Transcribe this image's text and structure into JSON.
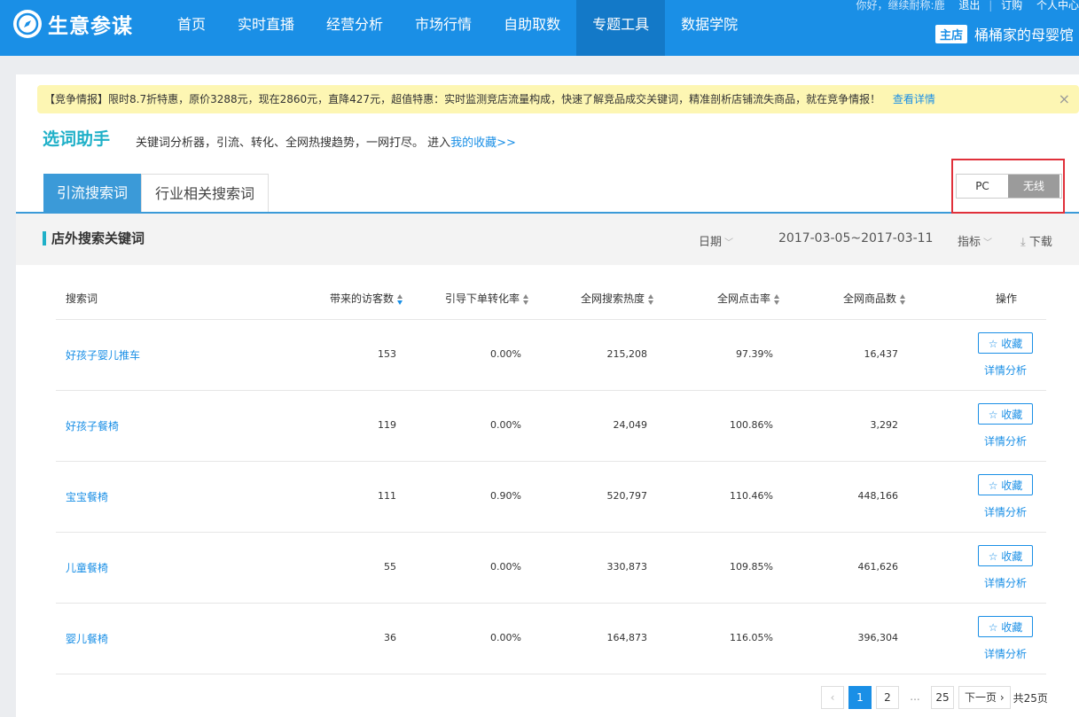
{
  "app": {
    "name": "生意参谋"
  },
  "nav": [
    {
      "label": "首页"
    },
    {
      "label": "实时直播"
    },
    {
      "label": "经营分析"
    },
    {
      "label": "市场行情"
    },
    {
      "label": "自助取数"
    },
    {
      "label": "专题工具",
      "active": true
    },
    {
      "label": "数据学院"
    }
  ],
  "user": {
    "greeting": "你好，继续耐称:鹿",
    "logout": "退出",
    "order": "订购",
    "personal": "个人中心",
    "shop_badge": "主店",
    "shop_name": "桶桶家的母婴馆"
  },
  "notice": {
    "text": "【竞争情报】限时8.7折特惠，原价3288元，现在2860元，直降427元，超值特惠：实时监测竞店流量构成，快速了解竞品成交关键词，精准剖析店铺流失商品，就在竞争情报！",
    "link": "查看详情",
    "close": "×"
  },
  "page": {
    "title": "选词助手",
    "subtitle": "关键词分析器，引流、转化、全网热搜趋势，一网打尽。 进入",
    "subtitle_link": "我的收藏>>"
  },
  "tabs": [
    {
      "label": "引流搜索词",
      "active": true
    },
    {
      "label": "行业相关搜索词",
      "active": false
    }
  ],
  "device": {
    "pc": "PC",
    "wireless": "无线",
    "selected": "无线"
  },
  "section": {
    "title": "店外搜索关键词",
    "date_label": "日期",
    "date_range": "2017-03-05~2017-03-11",
    "metric_label": "指标",
    "download": "下载"
  },
  "table": {
    "headers": {
      "keyword": "搜索词",
      "visitors": "带来的访客数",
      "conversion": "引导下单转化率",
      "search_heat": "全网搜索热度",
      "ctr": "全网点击率",
      "products": "全网商品数",
      "action": "操作"
    },
    "fav_label": "收藏",
    "detail_label": "详情分析",
    "rows": [
      {
        "keyword": "好孩子婴儿推车",
        "visitors": "153",
        "conversion": "0.00%",
        "search_heat": "215,208",
        "ctr": "97.39%",
        "products": "16,437"
      },
      {
        "keyword": "好孩子餐椅",
        "visitors": "119",
        "conversion": "0.00%",
        "search_heat": "24,049",
        "ctr": "100.86%",
        "products": "3,292"
      },
      {
        "keyword": "宝宝餐椅",
        "visitors": "111",
        "conversion": "0.90%",
        "search_heat": "520,797",
        "ctr": "110.46%",
        "products": "448,166"
      },
      {
        "keyword": "儿童餐椅",
        "visitors": "55",
        "conversion": "0.00%",
        "search_heat": "330,873",
        "ctr": "109.85%",
        "products": "461,626"
      },
      {
        "keyword": "婴儿餐椅",
        "visitors": "36",
        "conversion": "0.00%",
        "search_heat": "164,873",
        "ctr": "116.05%",
        "products": "396,304"
      }
    ]
  },
  "pagination": {
    "prev": "‹",
    "pages": [
      "1",
      "2"
    ],
    "current": "1",
    "ellipsis": "...",
    "last": "25",
    "next": "下一页",
    "total": "共25页"
  },
  "colors": {
    "brand": "#1a8fe6",
    "accent": "#1fb0c8",
    "highlight": "#e0303a"
  }
}
